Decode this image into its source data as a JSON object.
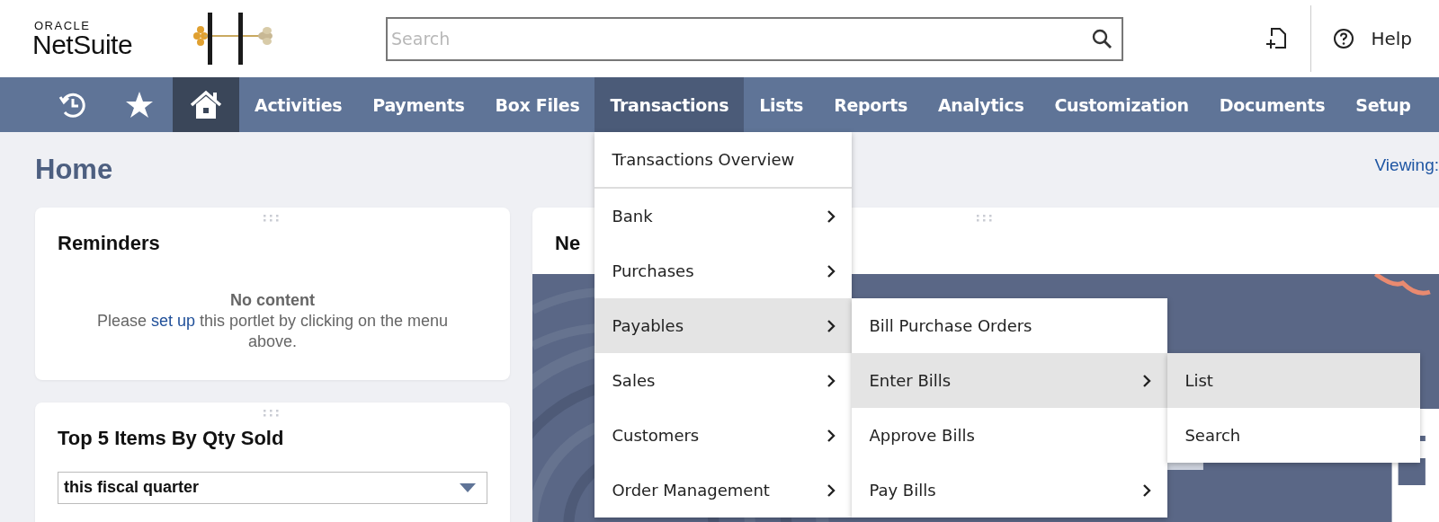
{
  "header": {
    "logo": {
      "brand": "ORACLE",
      "product": "NetSuite"
    },
    "search": {
      "placeholder": "Search"
    },
    "help": "Help"
  },
  "nav": {
    "icons": [
      {
        "kind": "recent",
        "selected": false
      },
      {
        "kind": "favorites",
        "selected": false
      },
      {
        "kind": "home",
        "selected": true
      }
    ],
    "tabs": [
      {
        "label": "Activities",
        "selected": false
      },
      {
        "label": "Payments",
        "selected": false
      },
      {
        "label": "Box Files",
        "selected": false
      },
      {
        "label": "Transactions",
        "selected": true
      },
      {
        "label": "Lists",
        "selected": false
      },
      {
        "label": "Reports",
        "selected": false
      },
      {
        "label": "Analytics",
        "selected": false
      },
      {
        "label": "Customization",
        "selected": false
      },
      {
        "label": "Documents",
        "selected": false
      },
      {
        "label": "Setup",
        "selected": false
      }
    ]
  },
  "menu": {
    "overview": "Transactions Overview",
    "items": [
      {
        "label": "Bank",
        "has_submenu": true,
        "selected": false
      },
      {
        "label": "Purchases",
        "has_submenu": true,
        "selected": false
      },
      {
        "label": "Payables",
        "has_submenu": true,
        "selected": true,
        "children": [
          {
            "label": "Bill Purchase Orders",
            "has_submenu": false,
            "selected": false
          },
          {
            "label": "Enter Bills",
            "has_submenu": true,
            "selected": true,
            "children": [
              {
                "label": "List",
                "has_submenu": false,
                "selected": true
              },
              {
                "label": "Search",
                "has_submenu": false,
                "selected": false
              }
            ]
          },
          {
            "label": "Approve Bills",
            "has_submenu": false,
            "selected": false
          },
          {
            "label": "Pay Bills",
            "has_submenu": true,
            "selected": false
          }
        ]
      },
      {
        "label": "Sales",
        "has_submenu": true,
        "selected": false
      },
      {
        "label": "Customers",
        "has_submenu": true,
        "selected": false
      },
      {
        "label": "Order Management",
        "has_submenu": true,
        "selected": false
      }
    ]
  },
  "page": {
    "title": "Home",
    "viewing": "Viewing:"
  },
  "portlets": [
    {
      "kind": "empty",
      "title": "Reminders",
      "empty_title": "No content",
      "message_before": "Please ",
      "link": "set up",
      "message_after": " this portlet by clicking on the menu above."
    },
    {
      "kind": "select",
      "title": "Top 5 Items By Qty Sold",
      "value": "this fiscal quarter"
    },
    {
      "kind": "banner",
      "title": "Ne"
    }
  ]
}
